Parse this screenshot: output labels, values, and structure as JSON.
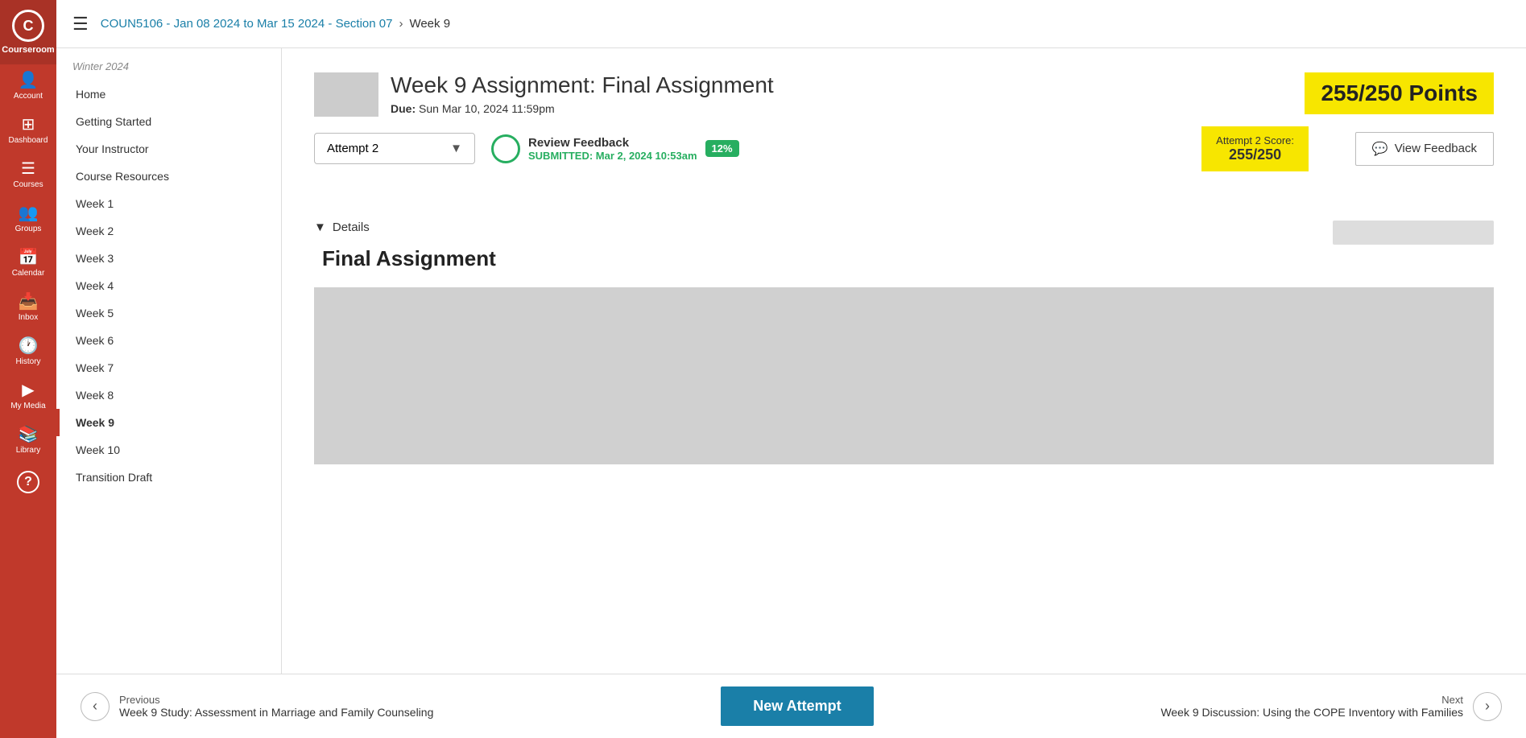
{
  "app": {
    "logo_letter": "C",
    "logo_label": "Courseroom"
  },
  "sidebar_icons": [
    {
      "id": "account",
      "icon": "👤",
      "label": "Account"
    },
    {
      "id": "dashboard",
      "icon": "📊",
      "label": "Dashboard"
    },
    {
      "id": "courses",
      "icon": "📋",
      "label": "Courses"
    },
    {
      "id": "groups",
      "icon": "👥",
      "label": "Groups"
    },
    {
      "id": "calendar",
      "icon": "📅",
      "label": "Calendar"
    },
    {
      "id": "inbox",
      "icon": "📥",
      "label": "Inbox"
    },
    {
      "id": "history",
      "icon": "🕐",
      "label": "History"
    },
    {
      "id": "my-media",
      "icon": "▶",
      "label": "My Media"
    },
    {
      "id": "library",
      "icon": "📚",
      "label": "Library"
    },
    {
      "id": "help",
      "icon": "?",
      "label": ""
    }
  ],
  "header": {
    "breadcrumb_course": "COUN5106 - Jan 08 2024 to Mar 15 2024 - Section 07",
    "breadcrumb_page": "Week 9",
    "hamburger_label": "☰"
  },
  "nav": {
    "season": "Winter 2024",
    "items": [
      {
        "label": "Home",
        "active": false
      },
      {
        "label": "Getting Started",
        "active": false
      },
      {
        "label": "Your Instructor",
        "active": false
      },
      {
        "label": "Course Resources",
        "active": false
      },
      {
        "label": "Week 1",
        "active": false
      },
      {
        "label": "Week 2",
        "active": false
      },
      {
        "label": "Week 3",
        "active": false
      },
      {
        "label": "Week 4",
        "active": false
      },
      {
        "label": "Week 5",
        "active": false
      },
      {
        "label": "Week 6",
        "active": false
      },
      {
        "label": "Week 7",
        "active": false
      },
      {
        "label": "Week 8",
        "active": false
      },
      {
        "label": "Week 9",
        "active": true
      },
      {
        "label": "Week 10",
        "active": false
      },
      {
        "label": "Transition Draft",
        "active": false
      }
    ]
  },
  "assignment": {
    "title": "Week 9 Assignment: Final Assignment",
    "due_label": "Due:",
    "due_date": "Sun Mar 10, 2024 11:59pm",
    "total_score": "255/250",
    "points_label": "Points"
  },
  "attempt": {
    "dropdown_label": "Attempt 2",
    "review_label": "Review Feedback",
    "submitted_label": "SUBMITTED: Mar 2, 2024 10:53am",
    "percent": "12%",
    "score_label": "Attempt 2 Score:",
    "score_value": "255/250",
    "view_feedback_label": "View Feedback"
  },
  "details": {
    "toggle_label": "Details",
    "assignment_title": "Final Assignment"
  },
  "bottom_nav": {
    "prev_label": "Previous",
    "prev_title": "Week 9 Study: Assessment in Marriage and Family Counseling",
    "next_label": "Next",
    "next_title": "Week 9 Discussion: Using the COPE Inventory with Families",
    "new_attempt_label": "New Attempt"
  }
}
